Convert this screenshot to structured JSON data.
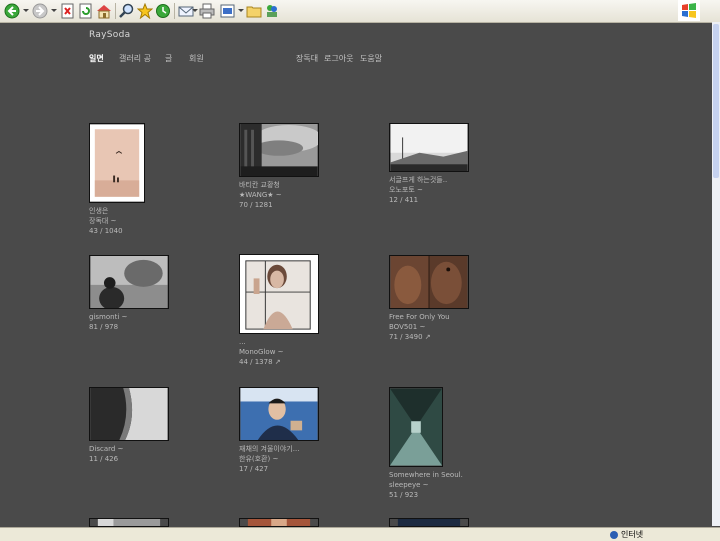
{
  "site": {
    "title": "RaySoda",
    "nav": [
      {
        "label": "일면",
        "active": true
      },
      {
        "label": "갤러리 공",
        "active": false
      },
      {
        "label": "글",
        "active": false
      },
      {
        "label": "회원",
        "active": false
      }
    ],
    "util_nav": [
      "장독대",
      "로그아웃",
      "도움말"
    ]
  },
  "photos": [
    {
      "title": "인생은",
      "author": "장독대 ~",
      "stats": "43 / 1040"
    },
    {
      "title": "바티칸 교황청",
      "author": "★WANG★ ~",
      "stats": "70 / 1281"
    },
    {
      "title": "서글프게 하는것들..",
      "author": "오노포토 ~",
      "stats": "12 / 411"
    },
    {
      "title": "gismonti ~",
      "author": "",
      "stats": "81 / 978"
    },
    {
      "title": "...",
      "author": "MonoGlow ~",
      "stats": "44 / 1378 ↗"
    },
    {
      "title": "Free For Only You",
      "author": "BOV501 ~",
      "stats": "71 / 3490 ↗"
    },
    {
      "title": "Discard ~",
      "author": "",
      "stats": "11 / 426"
    },
    {
      "title": "재채의 겨울이야기...",
      "author": "한유(호환) ~",
      "stats": "17 / 427"
    },
    {
      "title": "Somewhere in Seoul.",
      "author": "sleepeye ~",
      "stats": "51 / 923"
    }
  ],
  "statusbar": {
    "zone": "인터넷"
  },
  "icons": [
    "back-icon",
    "forward-icon",
    "stop-icon",
    "refresh-icon",
    "home-icon",
    "search-icon",
    "favorites-icon",
    "history-icon",
    "mail-icon",
    "print-icon",
    "edit-icon",
    "folder-icon",
    "messenger-icon",
    "windows-logo-icon"
  ]
}
